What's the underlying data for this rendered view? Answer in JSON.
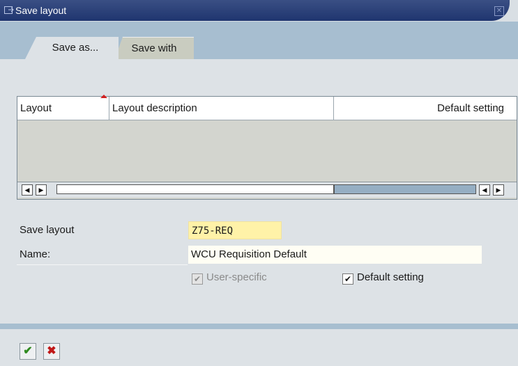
{
  "window": {
    "title": "Save layout"
  },
  "tabs": [
    {
      "label": "Save as...",
      "active": true
    },
    {
      "label": "Save with",
      "active": false
    }
  ],
  "grid": {
    "columns": [
      "Layout",
      "Layout description",
      "Default setting"
    ],
    "rows": []
  },
  "form": {
    "save_layout_label": "Save layout",
    "save_layout_value": "Z75-REQ",
    "name_label": "Name:",
    "name_value": "WCU Requisition Default",
    "user_specific_label": "User-specific",
    "user_specific_checked": true,
    "user_specific_enabled": false,
    "default_setting_label": "Default setting",
    "default_setting_checked": true
  },
  "colors": {
    "title_bar": "#1f356f",
    "tab_strip": "#a7bed0",
    "input_highlight": "#fff2a8",
    "ok_green": "#2f8a1f",
    "cancel_red": "#c01818"
  },
  "icons": {
    "title": "window-icon",
    "close": "close-icon",
    "scroll_left": "arrow-left-icon",
    "scroll_right": "arrow-right-icon",
    "ok": "checkmark-icon",
    "cancel": "cancel-x-icon"
  }
}
